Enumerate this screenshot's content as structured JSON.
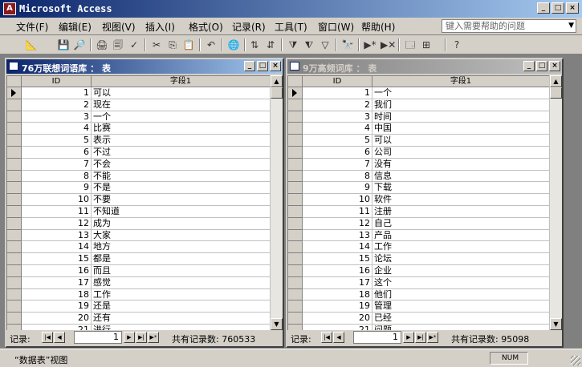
{
  "app": {
    "title": "Microsoft Access",
    "icon_letter": "A",
    "caption_buttons": [
      "_",
      "□",
      "×"
    ]
  },
  "menu": {
    "items": [
      "文件(F)",
      "编辑(E)",
      "视图(V)",
      "插入(I)",
      "格式(O)",
      "记录(R)",
      "工具(T)",
      "窗口(W)",
      "帮助(H)"
    ],
    "help_placeholder": "键入需要帮助的问题"
  },
  "toolbar": {
    "icons": [
      "design-view-icon",
      "save-icon",
      "search-file-icon",
      "print-icon",
      "print-preview-icon",
      "spelling-icon",
      "cut-icon",
      "copy-icon",
      "paste-icon",
      "undo-icon",
      "hyperlink-icon",
      "sort-ascending-icon",
      "sort-descending-icon",
      "filter-by-selection-icon",
      "filter-by-form-icon",
      "apply-filter-icon",
      "find-icon",
      "new-record-icon",
      "delete-record-icon",
      "database-window-icon",
      "new-object-icon",
      "help-icon"
    ]
  },
  "left_window": {
    "title": "76万联想词语库 ： 表",
    "columns": [
      "ID",
      "字段1"
    ],
    "rows": [
      [
        "1",
        "可以"
      ],
      [
        "2",
        "现在"
      ],
      [
        "3",
        "一个"
      ],
      [
        "4",
        "比赛"
      ],
      [
        "5",
        "表示"
      ],
      [
        "6",
        "不过"
      ],
      [
        "7",
        "不会"
      ],
      [
        "8",
        "不能"
      ],
      [
        "9",
        "不是"
      ],
      [
        "10",
        "不要"
      ],
      [
        "11",
        "不知道"
      ],
      [
        "12",
        "成为"
      ],
      [
        "13",
        "大家"
      ],
      [
        "14",
        "地方"
      ],
      [
        "15",
        "都是"
      ],
      [
        "16",
        "而且"
      ],
      [
        "17",
        "感觉"
      ],
      [
        "18",
        "工作"
      ],
      [
        "19",
        "还是"
      ],
      [
        "20",
        "还有"
      ],
      [
        "21",
        "进行"
      ]
    ],
    "nav": {
      "label": "记录:",
      "current": "1",
      "total": "共有记录数: 760533"
    }
  },
  "right_window": {
    "title": "9万高频词库 ： 表",
    "columns": [
      "ID",
      "字段1"
    ],
    "rows": [
      [
        "1",
        "一个"
      ],
      [
        "2",
        "我们"
      ],
      [
        "3",
        "时间"
      ],
      [
        "4",
        "中国"
      ],
      [
        "5",
        "可以"
      ],
      [
        "6",
        "公司"
      ],
      [
        "7",
        "没有"
      ],
      [
        "8",
        "信息"
      ],
      [
        "9",
        "下载"
      ],
      [
        "10",
        "软件"
      ],
      [
        "11",
        "注册"
      ],
      [
        "12",
        "自己"
      ],
      [
        "13",
        "产品"
      ],
      [
        "14",
        "工作"
      ],
      [
        "15",
        "论坛"
      ],
      [
        "16",
        "企业"
      ],
      [
        "17",
        "这个"
      ],
      [
        "18",
        "他们"
      ],
      [
        "19",
        "管理"
      ],
      [
        "20",
        "已经"
      ],
      [
        "21",
        "问题"
      ]
    ],
    "nav": {
      "label": "记录:",
      "current": "1",
      "total": "共有记录数: 95098"
    }
  },
  "status": {
    "text": "“数据表”视图",
    "num": "NUM"
  }
}
